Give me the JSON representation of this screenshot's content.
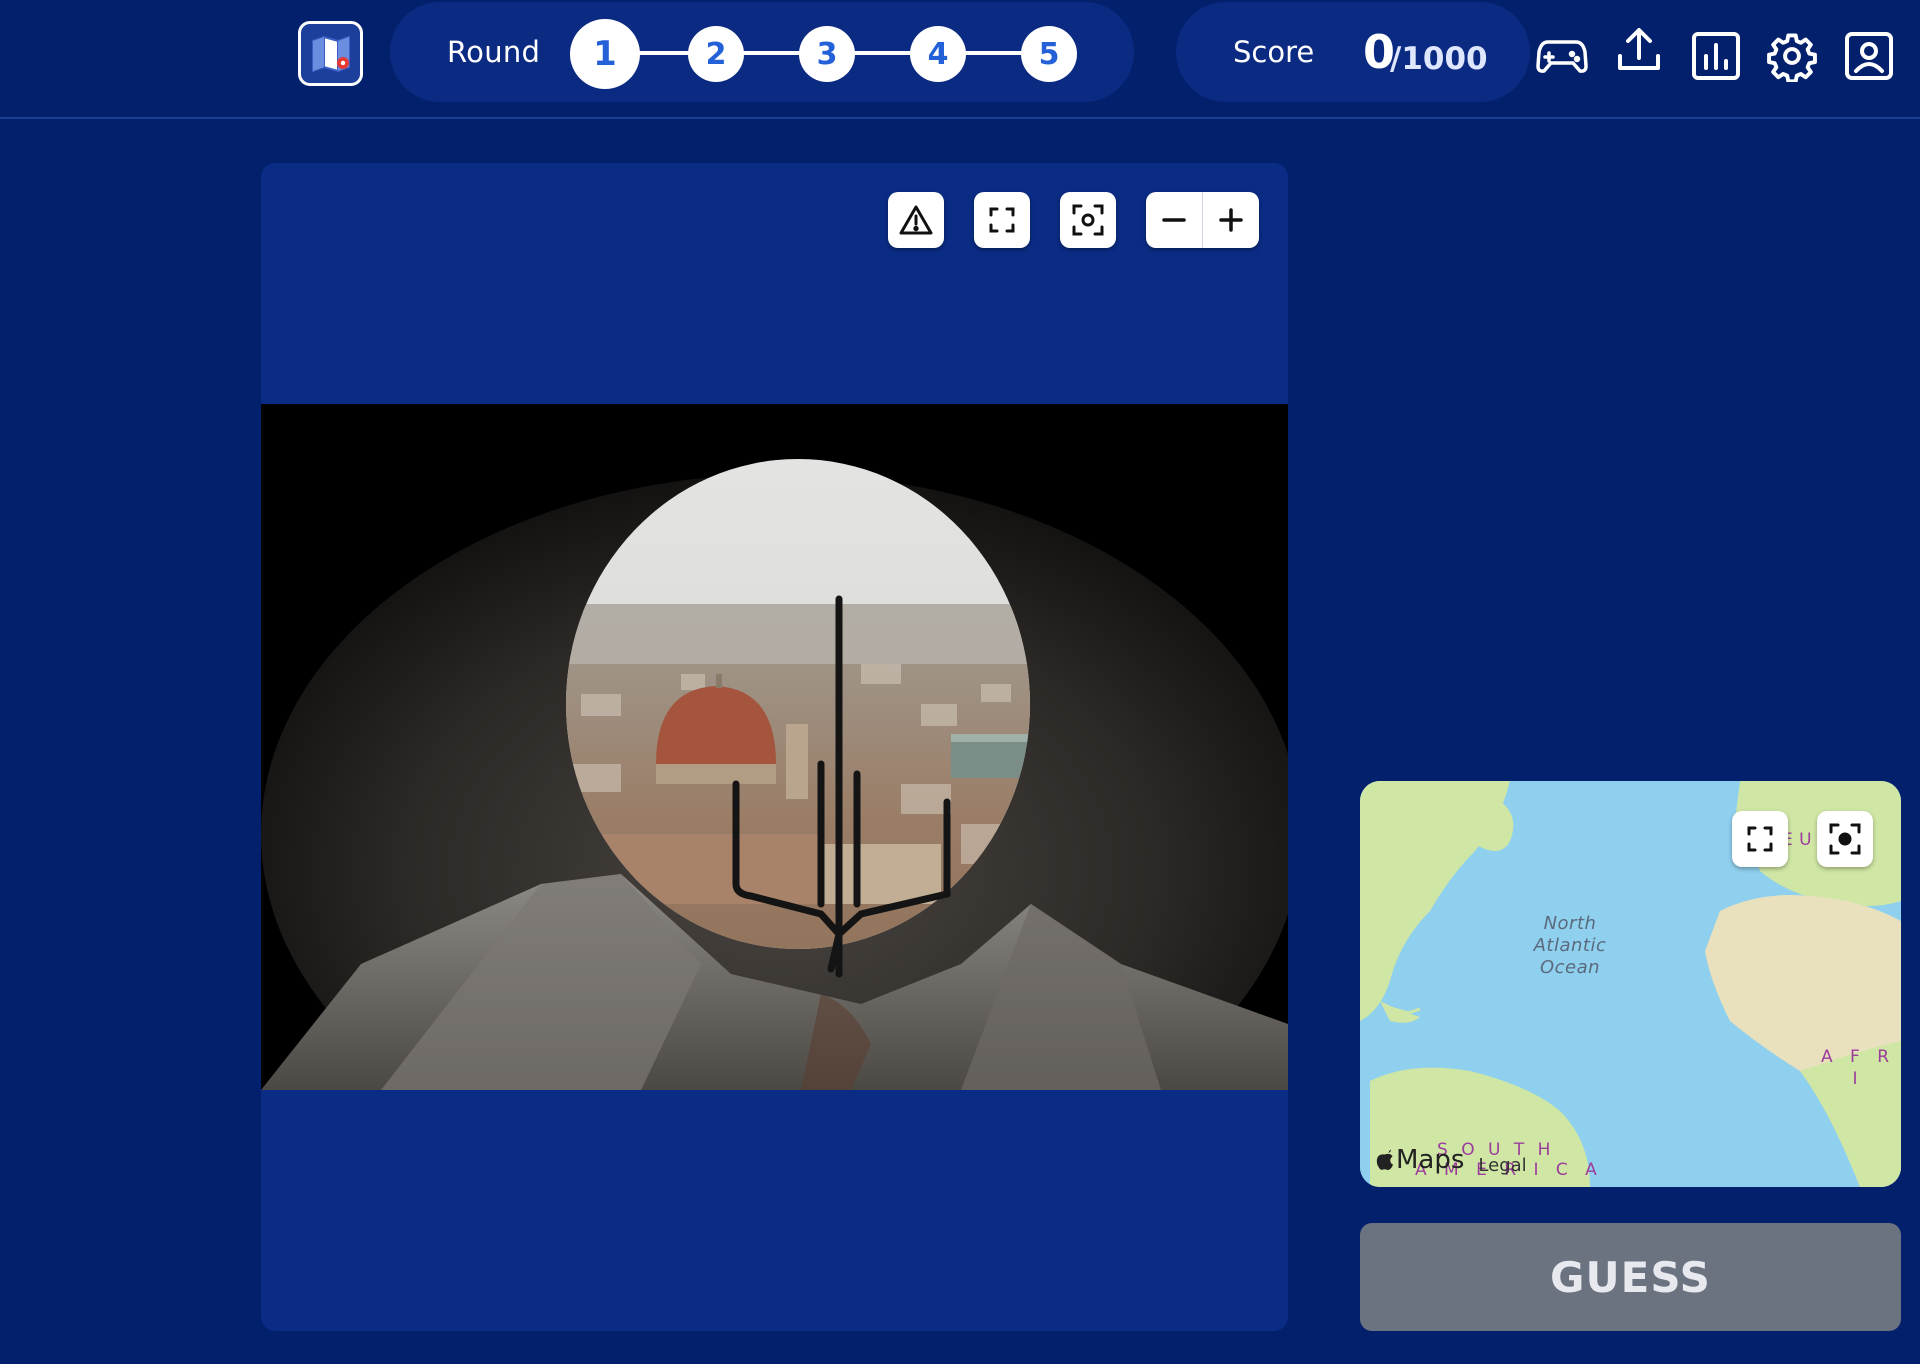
{
  "header": {
    "round_label": "Round",
    "rounds": [
      "1",
      "2",
      "3",
      "4",
      "5"
    ],
    "current_round": "1",
    "score_label": "Score",
    "score_value": "0",
    "score_max": "/1000"
  },
  "photo_controls": {
    "report_icon": "warning-triangle-icon",
    "fullscreen_icon": "expand-icon",
    "recenter_icon": "focus-icon",
    "zoom_out_icon": "minus-icon",
    "zoom_in_icon": "plus-icon"
  },
  "minimap": {
    "ocean_label": "North\nAtlantic\nOcean",
    "continent_labels": [
      "E U R O P",
      "A F R I",
      "S O U T H",
      "A M E R I C A"
    ],
    "attribution": "Maps",
    "legal_link": "Legal"
  },
  "guess_button": "GUESS",
  "colors": {
    "background": "#03206c",
    "panel": "#0a2c84",
    "pill": "#0b2a82",
    "round_number": "#2460d8",
    "guess_disabled": "#6b7280",
    "ocean": "#8fd0ee",
    "land": "#cfe6a4"
  }
}
